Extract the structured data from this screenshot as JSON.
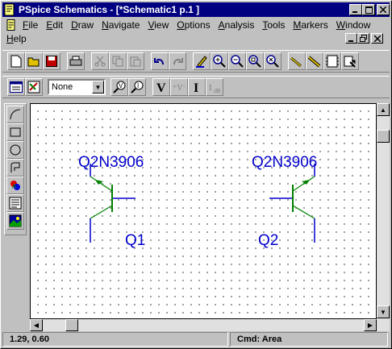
{
  "window": {
    "title": "PSpice Schematics - [*Schematic1  p.1  ]"
  },
  "menus": {
    "row1": [
      {
        "key": "F",
        "rest": "ile"
      },
      {
        "key": "E",
        "rest": "dit"
      },
      {
        "key": "D",
        "rest": "raw"
      },
      {
        "key": "N",
        "rest": "avigate"
      },
      {
        "key": "V",
        "rest": "iew"
      },
      {
        "key": "O",
        "rest": "ptions"
      },
      {
        "key": "A",
        "rest": "nalysis"
      },
      {
        "key": "T",
        "rest": "ools"
      },
      {
        "key": "M",
        "rest": "arkers"
      },
      {
        "key": "W",
        "rest": "indow"
      }
    ],
    "row2": [
      {
        "key": "H",
        "rest": "elp"
      }
    ]
  },
  "toolbar": {
    "level_select": "None"
  },
  "schematic": {
    "parts": [
      {
        "model": "Q2N3906",
        "ref": "Q1"
      },
      {
        "model": "Q2N3906",
        "ref": "Q2"
      }
    ]
  },
  "status": {
    "coords": "1.29,  0.60",
    "cmd": "Cmd: Area"
  },
  "colors": {
    "titlebar": "#000080",
    "wire": "#0000cc",
    "part": "#008000"
  }
}
